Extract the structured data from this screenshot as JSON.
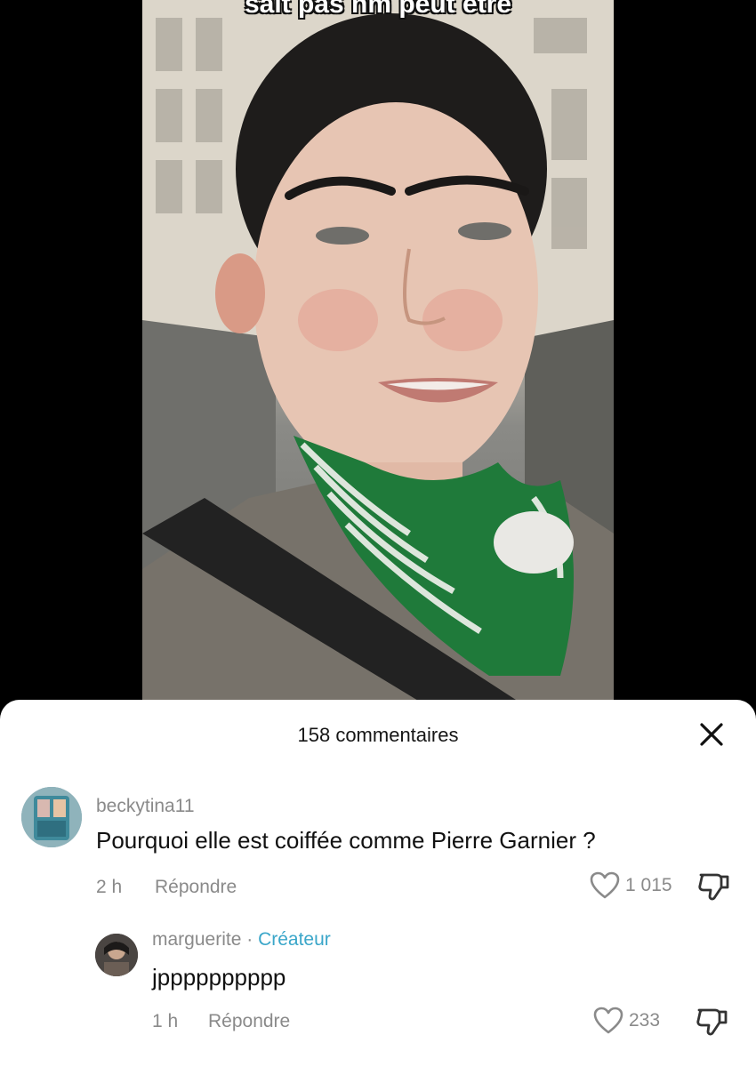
{
  "video": {
    "caption": "sait pas nm peut être"
  },
  "sheet": {
    "title": "158 commentaires"
  },
  "comments": [
    {
      "username": "beckytina11",
      "badge": "",
      "text": "Pourquoi elle est coiffée comme Pierre Garnier ?",
      "time": "2 h",
      "reply_label": "Répondre",
      "likes": "1 015"
    },
    {
      "username": "marguerite",
      "separator": "·",
      "badge": "Créateur",
      "text": "jpppppppppp",
      "time": "1 h",
      "reply_label": "Répondre",
      "likes": "233"
    }
  ],
  "colors": {
    "creator_badge": "#3aa6c9",
    "secondary_text": "#8a8a8a",
    "scarf_green": "#1f7a3a"
  },
  "icons": {
    "close": "close-icon",
    "like": "heart-icon",
    "dislike": "dislike-icon"
  }
}
